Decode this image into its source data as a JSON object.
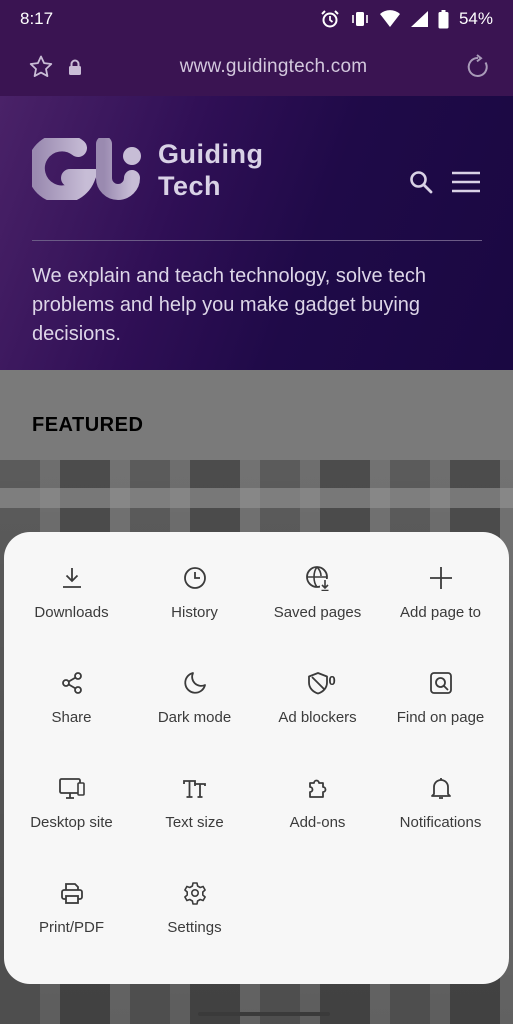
{
  "status_bar": {
    "time": "8:17",
    "battery": "54%"
  },
  "browser": {
    "url": "www.guidingtech.com"
  },
  "site": {
    "brand_line1": "Guiding",
    "brand_line2": "Tech",
    "tagline": "We explain and teach technology, solve tech problems and help you make gadget buying decisions.",
    "section_heading": "FEATURED"
  },
  "menu": {
    "items": [
      {
        "label": "Downloads",
        "icon": "download-icon"
      },
      {
        "label": "History",
        "icon": "clock-icon"
      },
      {
        "label": "Saved pages",
        "icon": "globe-download-icon"
      },
      {
        "label": "Add page to",
        "icon": "plus-icon"
      },
      {
        "label": "Share",
        "icon": "share-icon"
      },
      {
        "label": "Dark mode",
        "icon": "moon-icon"
      },
      {
        "label": "Ad blockers",
        "icon": "shield-icon",
        "badge": "0"
      },
      {
        "label": "Find on page",
        "icon": "find-page-icon"
      },
      {
        "label": "Desktop site",
        "icon": "desktop-icon"
      },
      {
        "label": "Text size",
        "icon": "text-size-icon"
      },
      {
        "label": "Add-ons",
        "icon": "puzzle-icon"
      },
      {
        "label": "Notifications",
        "icon": "bell-icon"
      },
      {
        "label": "Print/PDF",
        "icon": "printer-icon"
      },
      {
        "label": "Settings",
        "icon": "gear-icon"
      }
    ]
  },
  "colors": {
    "header_bg": "#3a1452",
    "hero_bg": "#1f0a48",
    "sheet_bg": "#f7f7f7"
  }
}
